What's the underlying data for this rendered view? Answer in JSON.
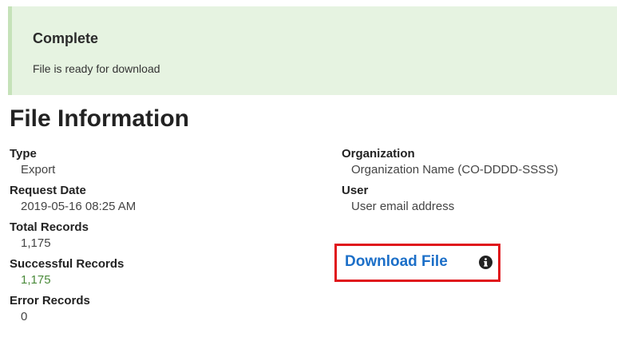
{
  "alert": {
    "title": "Complete",
    "message": "File is ready for download",
    "background_color": "#e6f3e1"
  },
  "section": {
    "title": "File Information"
  },
  "left_fields": [
    {
      "label": "Type",
      "value": "Export"
    },
    {
      "label": "Request Date",
      "value": "2019-05-16 08:25 AM"
    },
    {
      "label": "Total Records",
      "value": "1,175"
    },
    {
      "label": "Successful Records",
      "value": "1,175",
      "value_color": "#4a8a3a"
    },
    {
      "label": "Error Records",
      "value": "0"
    }
  ],
  "right_fields": [
    {
      "label": "Organization",
      "value": "Organization Name (CO-DDDD-SSSS)"
    },
    {
      "label": "User",
      "value": "User email address"
    }
  ],
  "download": {
    "label": "Download File",
    "icon": "info-circle-icon",
    "link_color": "#1c6fc8",
    "highlight_color": "#e0161c"
  }
}
